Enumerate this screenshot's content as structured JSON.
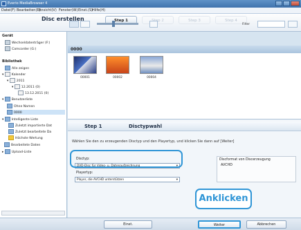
{
  "window": {
    "title": "Everio MediaBrowser 4"
  },
  "menu": [
    "Datei(F)",
    "Bearbeiten(E)",
    "Ansicht(V)",
    "Fenster(W)",
    "Einst.(S)",
    "Hilfe(H)"
  ],
  "header": {
    "title": "Disc erstellen",
    "steps": [
      "Step 1",
      "Step 2",
      "Step 3",
      "Step 4"
    ],
    "active_step": "Step 1",
    "filter_label": "Filter"
  },
  "sidebar": {
    "device_heading": "Gerät",
    "devices": [
      "Wechseldatenträger (F:)",
      "Camcorder (G:)"
    ],
    "library_heading": "Bibliothek",
    "library_items": [
      "Alle zeigen",
      "Kalender",
      "2011",
      "12.2011 (0)",
      "13.12.2011 (0)",
      "Benutzerliste",
      "Ohne Namen",
      "0000",
      "Intelligente Liste",
      "Zuletzt importierte Dat",
      "Zuletzt bearbeitete Da",
      "Höchste Wertung",
      "Bearbeitete Daten",
      "Upload-Liste"
    ]
  },
  "content": {
    "folder_title": "0000",
    "thumbnails": [
      {
        "label": "00001"
      },
      {
        "label": "00002"
      },
      {
        "label": "00004"
      }
    ]
  },
  "wizard": {
    "step_label": "Step 1",
    "title": "Disctypwahl",
    "description": "Wählen Sie den zu erzeugenden Disctyp und den Playertyp, und klicken Sie dann auf [Weiter]",
    "disctype_label": "Disctyp:",
    "disctype_value": "DVD-Disc für Video- u. Datenaufzeichnung",
    "disc_format_label": "Discformat von Discerzeugung",
    "disc_format_value": "AVCHD",
    "playertype_label": "Playertyp:",
    "playertype_value": "Player, die AVCHD unterstützen"
  },
  "callout": {
    "text": "Anklicken"
  },
  "buttons": {
    "back": "Einst.",
    "next": "Weiter",
    "cancel": "Abbrechen"
  },
  "colors": {
    "accent": "#2f95d6",
    "titlebar": "#4a7db8"
  }
}
